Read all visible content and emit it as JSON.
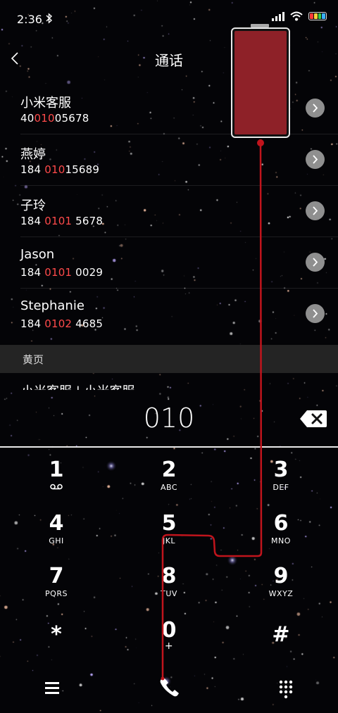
{
  "status": {
    "time": "2:36"
  },
  "header": {
    "title": "通话"
  },
  "calls": [
    {
      "name": "小米客服",
      "num_pre": "40",
      "num_hl": "010",
      "num_post": "05678"
    },
    {
      "name": "燕婷",
      "num_pre": "184 ",
      "num_hl": "010",
      "num_post": "15689"
    },
    {
      "name": "子玲",
      "num_pre": "184 ",
      "num_hl": "0101",
      "num_post": " 5678"
    },
    {
      "name": "Jason",
      "num_pre": "184 ",
      "num_hl": "0101",
      "num_post": " 0029"
    },
    {
      "name": "Stephanie",
      "num_pre": "184 ",
      "num_hl": "0102",
      "num_post": " 4685"
    }
  ],
  "section": {
    "label": "黄页",
    "partial_text": "小米客服 | 小米客服"
  },
  "dial": {
    "display": "010"
  },
  "keys": [
    {
      "digit": "1",
      "letters": ""
    },
    {
      "digit": "2",
      "letters": "ABC"
    },
    {
      "digit": "3",
      "letters": "DEF"
    },
    {
      "digit": "4",
      "letters": "GHI"
    },
    {
      "digit": "5",
      "letters": "JKL"
    },
    {
      "digit": "6",
      "letters": "MNO"
    },
    {
      "digit": "7",
      "letters": "PQRS"
    },
    {
      "digit": "8",
      "letters": "TUV"
    },
    {
      "digit": "9",
      "letters": "WXYZ"
    },
    {
      "digit": "*",
      "letters": ""
    },
    {
      "digit": "0",
      "letters": "+"
    },
    {
      "digit": "#",
      "letters": ""
    }
  ],
  "icons": {
    "bluetooth": "bluetooth-icon",
    "signal": "signal-icon",
    "wifi": "wifi-icon",
    "battery": "battery-icon",
    "back": "back-arrow-icon",
    "row_arrow": "chevron-right-icon",
    "delete": "backspace-icon",
    "voicemail": "voicemail-icon",
    "menu": "menu-icon",
    "call": "phone-call-icon",
    "keypad": "keypad-icon"
  },
  "colors": {
    "highlight": "#ff4a4a",
    "accent_red": "#c0141c",
    "phone_screen": "#8e2128",
    "background": "#040407"
  }
}
